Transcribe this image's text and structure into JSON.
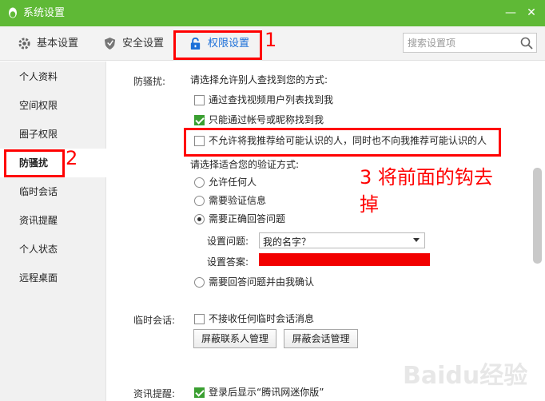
{
  "window": {
    "title": "系统设置",
    "accent_color": "#5fb936",
    "icons": [
      "qq-penguin-icon",
      "minimize-icon",
      "close-icon"
    ]
  },
  "tabs": [
    {
      "label": "基本设置",
      "icon": "gear-icon"
    },
    {
      "label": "安全设置",
      "icon": "shield-icon"
    },
    {
      "label": "权限设置",
      "icon": "lock-icon",
      "active": true
    }
  ],
  "search": {
    "placeholder": "搜索设置项",
    "value": ""
  },
  "sidebar": {
    "items": [
      {
        "label": "个人资料"
      },
      {
        "label": "空间权限"
      },
      {
        "label": "圈子权限"
      },
      {
        "label": "防骚扰",
        "active": true
      },
      {
        "label": "临时会话"
      },
      {
        "label": "资讯提醒"
      },
      {
        "label": "个人状态"
      },
      {
        "label": "远程桌面"
      }
    ]
  },
  "anti_harass": {
    "label": "防骚扰:",
    "find_prompt": "请选择允许别人查找到您的方式:",
    "find_options": [
      {
        "label": "通过查找视频用户列表找到我",
        "checked": false
      },
      {
        "label": "只能通过帐号或昵称找到我",
        "checked": true
      },
      {
        "label": "不允许将我推荐给可能认识的人，同时也不向我推荐可能认识的人",
        "checked": false
      }
    ],
    "verify_prompt": "请选择适合您的验证方式:",
    "verify_options": [
      {
        "label": "允许任何人",
        "selected": false
      },
      {
        "label": "需要验证信息",
        "selected": false
      },
      {
        "label": "需要正确回答问题",
        "selected": true
      },
      {
        "label": "需要回答问题并由我确认",
        "selected": false
      }
    ],
    "question_label": "设置问题:",
    "question_value": "我的名字？",
    "answer_label": "设置答案:"
  },
  "temp_session": {
    "label": "临时会话:",
    "option": {
      "label": "不接收任何临时会话消息",
      "checked": false
    },
    "buttons": [
      "屏蔽联系人管理",
      "屏蔽会话管理"
    ]
  },
  "news": {
    "label": "资讯提醒:",
    "option": {
      "label": "登录后显示“腾讯网迷你版”",
      "checked": true
    }
  },
  "annotations": {
    "n1": "1",
    "n2": "2",
    "n3_line1": "3 将前面的钩去",
    "n3_line2": "掉",
    "color": "#ff0000"
  },
  "watermark": "Baidu经验"
}
